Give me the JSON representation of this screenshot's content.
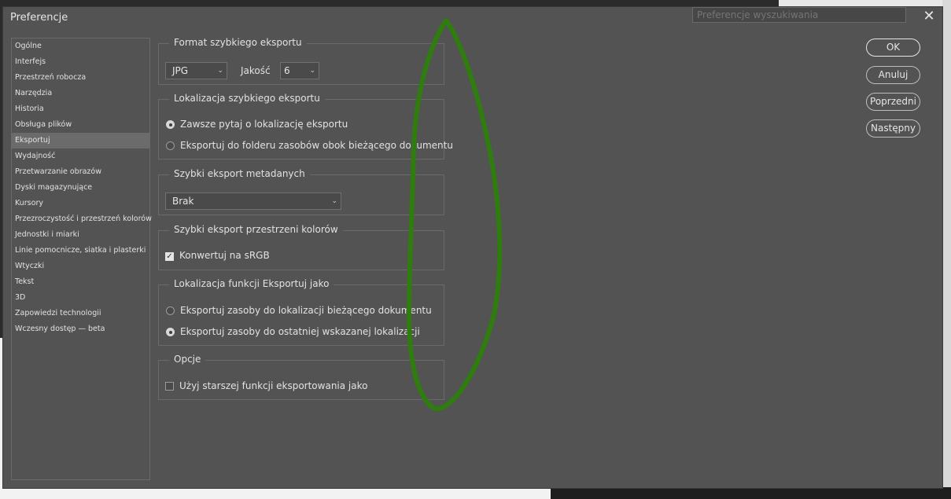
{
  "dialog": {
    "title": "Preferencje",
    "search_placeholder": "Preferencje wyszukiwania",
    "close_glyph": "✕"
  },
  "sidebar": {
    "items": [
      {
        "label": "Ogólne",
        "selected": false
      },
      {
        "label": "Interfejs",
        "selected": false
      },
      {
        "label": "Przestrzeń robocza",
        "selected": false
      },
      {
        "label": "Narzędzia",
        "selected": false
      },
      {
        "label": "Historia",
        "selected": false
      },
      {
        "label": "Obsługa plików",
        "selected": false
      },
      {
        "label": "Eksportuj",
        "selected": true
      },
      {
        "label": "Wydajność",
        "selected": false
      },
      {
        "label": "Przetwarzanie obrazów",
        "selected": false
      },
      {
        "label": "Dyski magazynujące",
        "selected": false
      },
      {
        "label": "Kursory",
        "selected": false
      },
      {
        "label": "Przezroczystość i przestrzeń kolorów",
        "selected": false
      },
      {
        "label": "Jednostki i miarki",
        "selected": false
      },
      {
        "label": "Linie pomocnicze, siatka i plasterki",
        "selected": false
      },
      {
        "label": "Wtyczki",
        "selected": false
      },
      {
        "label": "Tekst",
        "selected": false
      },
      {
        "label": "3D",
        "selected": false
      },
      {
        "label": "Zapowiedzi technologii",
        "selected": false
      },
      {
        "label": "Wczesny dostęp — beta",
        "selected": false
      }
    ]
  },
  "quick_export_format": {
    "title": "Format szybkiego eksportu",
    "format_value": "JPG",
    "quality_label": "Jakość",
    "quality_value": "6"
  },
  "quick_export_location": {
    "title": "Lokalizacja szybkiego eksportu",
    "option_always_ask": "Zawsze pytaj o lokalizację eksportu",
    "option_assets_folder": "Eksportuj do folderu zasobów obok bieżącego dokumentu",
    "selected": "always_ask"
  },
  "quick_export_metadata": {
    "title": "Szybki eksport metadanych",
    "value": "Brak"
  },
  "quick_export_colorspace": {
    "title": "Szybki eksport przestrzeni kolorów",
    "convert_srgb_label": "Konwertuj na sRGB",
    "convert_srgb_checked": true
  },
  "export_as_location": {
    "title": "Lokalizacja funkcji Eksportuj jako",
    "option_current_doc": "Eksportuj zasoby do lokalizacji bieżącego dokumentu",
    "option_last_location": "Eksportuj zasoby do ostatniej wskazanej lokalizacji",
    "selected": "last_location"
  },
  "options": {
    "title": "Opcje",
    "legacy_export_label": "Użyj starszej funkcji eksportowania jako",
    "legacy_export_checked": false
  },
  "buttons": {
    "ok": "OK",
    "cancel": "Anuluj",
    "previous": "Poprzedni",
    "next": "Następny"
  },
  "colors": {
    "dialog_bg": "#535353",
    "annotation_stroke": "#2e7d0e"
  }
}
